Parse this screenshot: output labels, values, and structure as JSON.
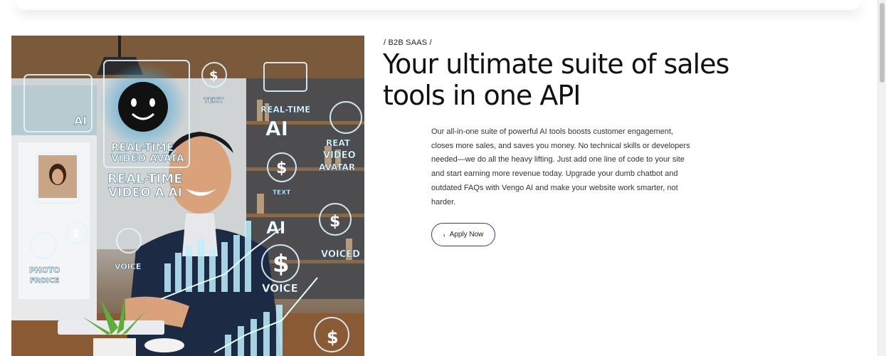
{
  "hero": {
    "eyebrow": "/ B2B SAAS /",
    "title": "Your ultimate suite of sales tools in one API",
    "description": "Our all-in-one suite of powerful AI tools boosts customer engagement, closes more sales, and saves you money. No technical skills or developers needed—we do all the heavy lifting. Just add one line of code to your site and start earning more revenue today. Upgrade your dumb chatbot and outdated FAQs with Vengo AI and make your website work smarter, not harder.",
    "cta_label": "Apply Now",
    "cta_icon": "chevron-right-icon"
  },
  "image_labels": {
    "ai_left": "AI",
    "text_top": "TEXT",
    "realtime_1": "REAL-TIME",
    "video_avatar_1": "VIDEO AVATA",
    "realtime_2": "REAL-TIME",
    "video_ai": "VIDEO A AI",
    "realtime_right": "REAL-TIME",
    "ai_right": "AI",
    "reat": "REAT",
    "video": "VIDEO",
    "avatar": "AVATAR",
    "text_small": "TEXT",
    "ai_lower": "AI",
    "voiced": "VOICED",
    "voice_center": "VOICE",
    "voice_lower": "VOICE",
    "photo": "PHOTO",
    "froice": "FROICE"
  },
  "colors": {
    "accent_border": "#5b2a86",
    "hologram": "#7fd6ff"
  }
}
